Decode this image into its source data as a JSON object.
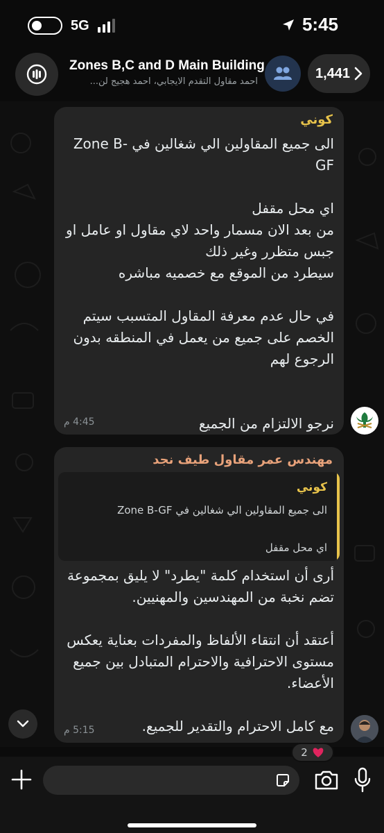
{
  "status_bar": {
    "network": "5G",
    "time": "5:45"
  },
  "header": {
    "title": "Zones B,C and D Main Building",
    "subtitle": "احمد مقاول التقدم الايجابي، احمد هجيج لن...",
    "member_count": "1,441"
  },
  "messages": [
    {
      "sender": "كوني",
      "text": "الى جميع المقاولين الي شغالين في Zone B-GF\n\nاي محل مقفل\n من بعد الان مسمار واحد لاي مقاول او عامل او جبس متظرر  وغير ذلك\nسيطرد من الموقع مع خصميه مباشره\n\nفي حال عدم معرفة المقاول المتسبب سيتم الخصم على جميع من يعمل في المنطقه بدون الرجوع لهم\n\n\nنرجو الالتزام من الجميع",
      "time": "4:45 م"
    },
    {
      "sender": "مهندس عمر مقاول طيف نجد",
      "quote": {
        "sender": "كوني",
        "text": "الى جميع المقاولين الي شغالين في Zone B-GF\n\nاي محل مقفل"
      },
      "text": "أرى أن استخدام كلمة \"يطرد\" لا يليق بمجموعة تضم نخبة من المهندسين والمهنيين.\n\nأعتقد أن انتقاء الألفاظ والمفردات بعناية يعكس مستوى الاحترافية والاحترام المتبادل بين جميع الأعضاء.\n\nمع كامل الاحترام والتقدير للجميع.",
      "time": "5:15 م",
      "reaction": {
        "emoji": "heart-icon",
        "count": "2"
      }
    }
  ],
  "composer": {
    "placeholder": ""
  },
  "colors": {
    "sender_konee": "#e8c34b",
    "sender_omar": "#e8a27a",
    "bubble": "#252525",
    "background": "#0f0f0f"
  }
}
